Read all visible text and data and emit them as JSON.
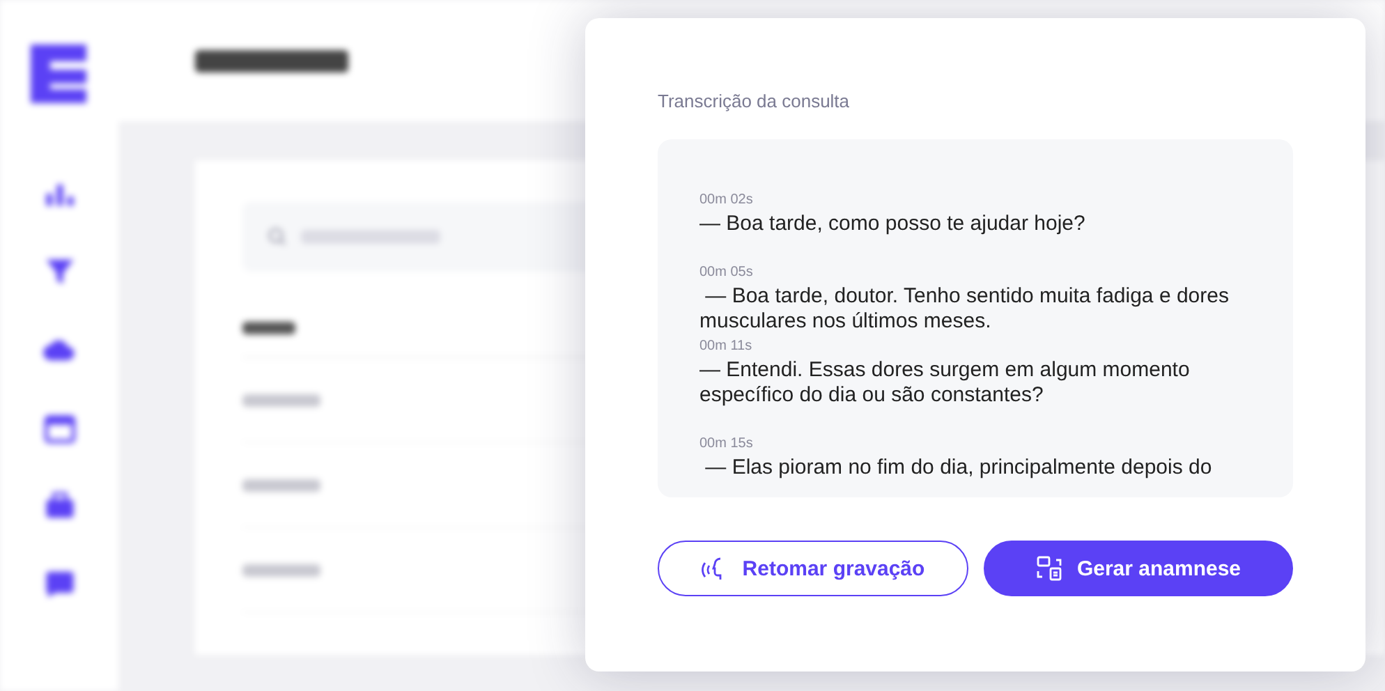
{
  "modal": {
    "title": "Transcrição da consulta",
    "entries": [
      {
        "time": "00m 02s",
        "text": "— Boa tarde, como posso te ajudar hoje?"
      },
      {
        "time": "00m 05s",
        "text": " — Boa tarde, doutor. Tenho sentido muita fadiga e dores musculares nos últimos meses."
      },
      {
        "time": "00m 11s",
        "text": "— Entendi. Essas dores surgem em algum momento específico do dia ou são constantes?"
      },
      {
        "time": "00m 15s",
        "text": " — Elas pioram no fim do dia, principalmente depois do"
      }
    ],
    "buttons": [
      {
        "label": "Retomar gravação",
        "kind": "outline"
      },
      {
        "label": "Gerar anamnese",
        "kind": "primary"
      }
    ]
  }
}
